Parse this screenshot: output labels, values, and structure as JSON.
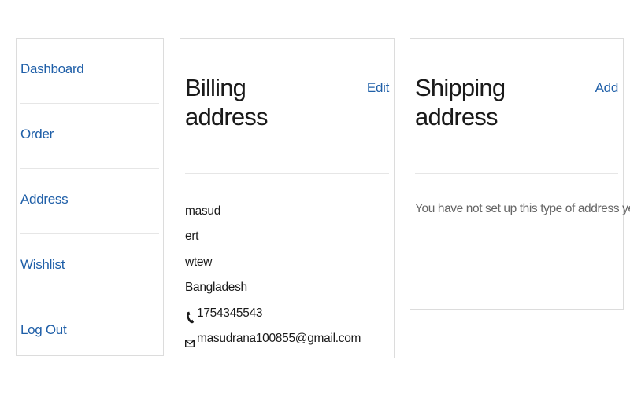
{
  "sidebar": {
    "items": [
      {
        "label": "Dashboard"
      },
      {
        "label": "Order"
      },
      {
        "label": "Address"
      },
      {
        "label": "Wishlist"
      },
      {
        "label": "Log Out"
      }
    ]
  },
  "billing": {
    "title": "Billing address",
    "action_label": "Edit",
    "lines": [
      "masud",
      "ert",
      "wtew",
      "Bangladesh"
    ],
    "phone": "1754345543",
    "email": "masudrana100855@gmail.com",
    "phone_icon": "phone-icon",
    "email_icon": "envelope-icon"
  },
  "shipping": {
    "title": "Shipping address",
    "action_label": "Add",
    "empty_message": "You have not set up this type of address yet."
  },
  "colors": {
    "link": "#1f5fa8",
    "text": "#1a1a1a",
    "muted": "#666666",
    "border": "#dcdcdc"
  }
}
